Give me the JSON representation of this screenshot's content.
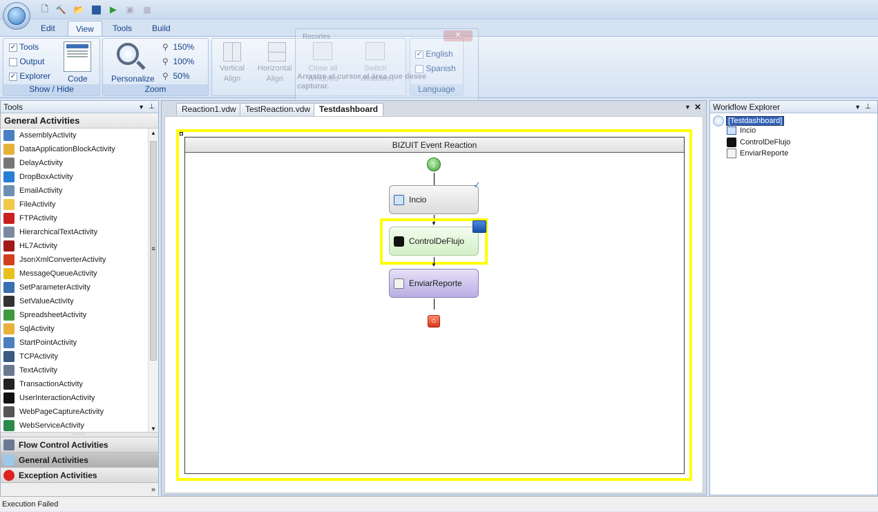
{
  "ribbon": {
    "tabs": [
      "Edit",
      "View",
      "Tools",
      "Build"
    ],
    "active_tab": "View",
    "show_hide": {
      "items": [
        {
          "label": "Tools",
          "checked": true
        },
        {
          "label": "Output",
          "checked": false
        },
        {
          "label": "Explorer",
          "checked": true
        }
      ],
      "code_label": "Code",
      "group_label": "Show / Hide"
    },
    "zoom": {
      "personalize_label": "Personalize",
      "levels": [
        "150%",
        "100%",
        "50%"
      ],
      "group_label": "Zoom"
    },
    "layout": {
      "vertical_align": "Vertical\nAlign",
      "horizontal_align": "Horizontal\nAlign",
      "close_all_windows": "Close all\nWindows",
      "switch_windows": "Switch\nWindows"
    },
    "language": {
      "items": [
        {
          "label": "English",
          "checked": true
        },
        {
          "label": "Spanish",
          "checked": false
        }
      ],
      "group_label": "Language"
    },
    "ghost_dialog": {
      "title": "Recortes",
      "text": "Arrastre el cursor al área que desee capturar."
    }
  },
  "tools_panel": {
    "title": "Tools",
    "section": "General Activities",
    "items": [
      {
        "label": "AssemblyActivity",
        "icon": "assembly-icon",
        "color": "#4a7fc0"
      },
      {
        "label": "DataApplicationBlockActivity",
        "icon": "database-icon",
        "color": "#e8b23a"
      },
      {
        "label": "DelayActivity",
        "icon": "stopwatch-icon",
        "color": "#777777"
      },
      {
        "label": "DropBoxActivity",
        "icon": "dropbox-icon",
        "color": "#2a7fd4"
      },
      {
        "label": "EmailActivity",
        "icon": "email-icon",
        "color": "#6f8fb0"
      },
      {
        "label": "FileActivity",
        "icon": "folder-icon",
        "color": "#f0c94a"
      },
      {
        "label": "FTPActivity",
        "icon": "ftp-icon",
        "color": "#c8201f"
      },
      {
        "label": "HierarchicalTextActivity",
        "icon": "document-icon",
        "color": "#7a8aa0"
      },
      {
        "label": "HL7Activity",
        "icon": "hl7-icon",
        "color": "#a01a1a"
      },
      {
        "label": "JsonXmlConverterActivity",
        "icon": "code-icon",
        "color": "#d04020"
      },
      {
        "label": "MessageQueueActivity",
        "icon": "envelope-icon",
        "color": "#e8c020"
      },
      {
        "label": "SetParameterActivity",
        "icon": "parameter-icon",
        "color": "#3a6fb0"
      },
      {
        "label": "SetValueActivity",
        "icon": "setvalue-icon",
        "color": "#333333"
      },
      {
        "label": "SpreadsheetActivity",
        "icon": "spreadsheet-icon",
        "color": "#3f9a3f"
      },
      {
        "label": "SqlActivity",
        "icon": "database-icon",
        "color": "#e8b23a"
      },
      {
        "label": "StartPointActivity",
        "icon": "startpoint-icon",
        "color": "#4a7fc0"
      },
      {
        "label": "TCPActivity",
        "icon": "network-icon",
        "color": "#3a5a80"
      },
      {
        "label": "TextActivity",
        "icon": "text-file-icon",
        "color": "#6a7a90"
      },
      {
        "label": "TransactionActivity",
        "icon": "transaction-icon",
        "color": "#222222"
      },
      {
        "label": "UserInteractionActivity",
        "icon": "user-interaction-icon",
        "color": "#111111"
      },
      {
        "label": "WebPageCaptureActivity",
        "icon": "webpage-icon",
        "color": "#555555"
      },
      {
        "label": "WebServiceActivity",
        "icon": "globe-icon",
        "color": "#2a8a4a"
      }
    ],
    "categories": [
      {
        "label": "Flow Control Activities",
        "icon": "flow-icon",
        "selected": false
      },
      {
        "label": "General Activities",
        "icon": "gear-icon",
        "selected": true
      },
      {
        "label": "Exception Activities",
        "icon": "error-icon",
        "selected": false
      }
    ]
  },
  "document": {
    "tabs": [
      "Reaction1.vdw",
      "TestReaction.vdw",
      "Testdashboard"
    ],
    "active_tab": "Testdashboard",
    "workflow_title": "BIZUIT Event Reaction",
    "nodes": [
      {
        "label": "Incio",
        "icon": "start-point-icon"
      },
      {
        "label": "ControlDeFlujo",
        "icon": "user-interaction-icon"
      },
      {
        "label": "EnviarReporte",
        "icon": "send-report-icon"
      }
    ]
  },
  "explorer": {
    "title": "Workflow Explorer",
    "root": "[Testdashboard]",
    "children": [
      "Incio",
      "ControlDeFlujo",
      "EnviarReporte"
    ]
  },
  "status": {
    "text": "Execution Failed"
  },
  "colors": {
    "selection_frame": "#ffff00",
    "node_incio": "#e8e8e8",
    "node_control": "#dff5d8",
    "node_enviar": "#cbc3ec"
  }
}
